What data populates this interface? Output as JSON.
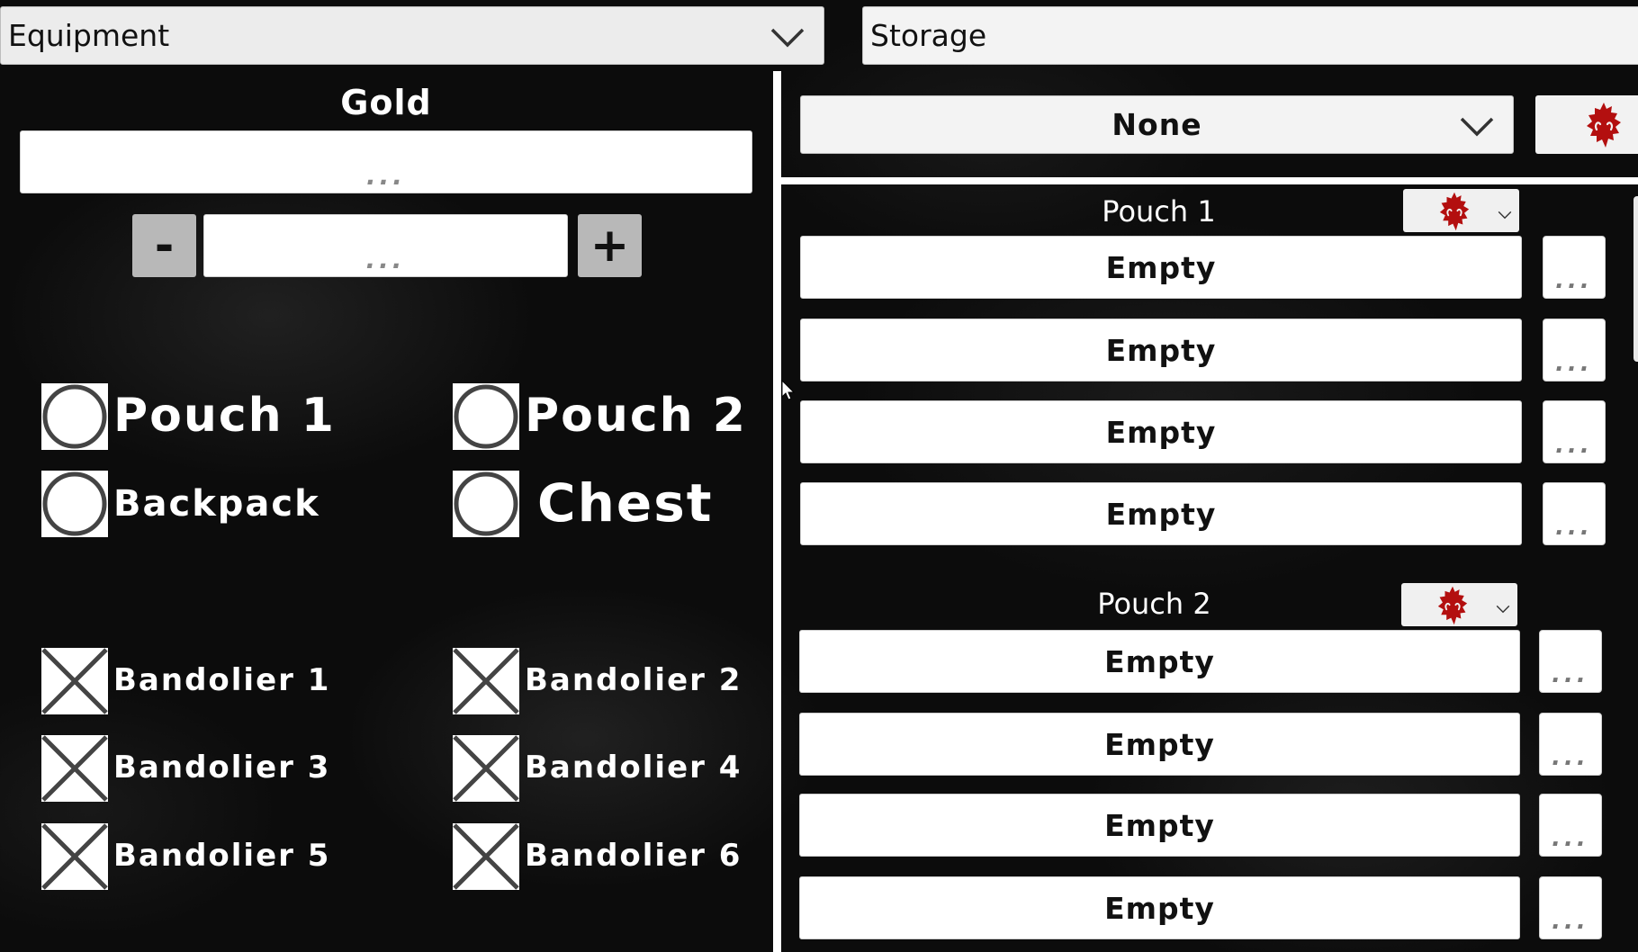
{
  "top_dropdowns": {
    "left": {
      "value": "Equipment",
      "icon": "chevron-down-icon"
    },
    "right": {
      "value": "Storage",
      "icon": "chevron-down-icon"
    }
  },
  "equipment": {
    "gold": {
      "label": "Gold",
      "value_placeholder": "...",
      "stepper": {
        "minus_label": "-",
        "plus_label": "+",
        "amount_placeholder": "..."
      }
    },
    "containers": [
      {
        "label": "Pouch 1",
        "type": "radio",
        "selected": false
      },
      {
        "label": "Pouch 2",
        "type": "radio",
        "selected": false
      },
      {
        "label": "Backpack",
        "type": "radio",
        "selected": false
      },
      {
        "label": "Chest",
        "type": "radio",
        "selected": false
      }
    ],
    "bandoliers": [
      {
        "label": "Bandolier 1",
        "state": "disabled"
      },
      {
        "label": "Bandolier 2",
        "state": "disabled"
      },
      {
        "label": "Bandolier 3",
        "state": "disabled"
      },
      {
        "label": "Bandolier 4",
        "state": "disabled"
      },
      {
        "label": "Bandolier 5",
        "state": "disabled"
      },
      {
        "label": "Bandolier 6",
        "state": "disabled"
      }
    ]
  },
  "storage": {
    "filter": {
      "value": "None",
      "icon": "chevron-down-icon"
    },
    "emblem_button": {
      "icon": "red-spiked-emblem-icon"
    },
    "emblem_color": "#b30f0f",
    "sections": [
      {
        "label": "Pouch 1",
        "selector_icon": "red-spiked-emblem-icon",
        "slots": [
          {
            "value": "Empty",
            "more_label": "..."
          },
          {
            "value": "Empty",
            "more_label": "..."
          },
          {
            "value": "Empty",
            "more_label": "..."
          },
          {
            "value": "Empty",
            "more_label": "..."
          }
        ]
      },
      {
        "label": "Pouch 2",
        "selector_icon": "red-spiked-emblem-icon",
        "slots": [
          {
            "value": "Empty",
            "more_label": "..."
          },
          {
            "value": "Empty",
            "more_label": "..."
          },
          {
            "value": "Empty",
            "more_label": "..."
          },
          {
            "value": "Empty",
            "more_label": "..."
          }
        ]
      }
    ]
  }
}
